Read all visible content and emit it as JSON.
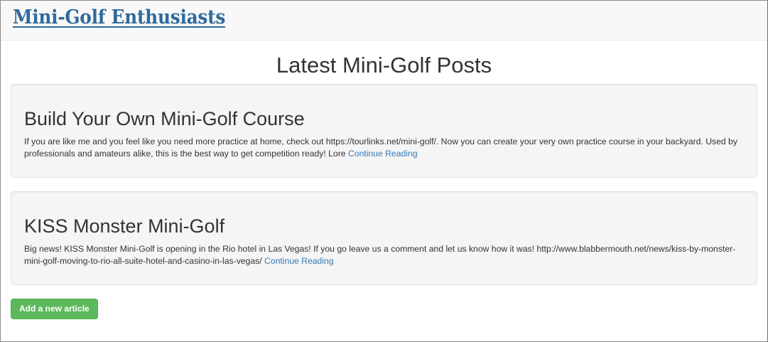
{
  "navbar": {
    "brand": "Mini-Golf Enthusiasts"
  },
  "main": {
    "title": "Latest Mini-Golf Posts",
    "posts": [
      {
        "title": "Build Your Own Mini-Golf Course",
        "excerpt": "If you are like me and you feel like you need more practice at home, check out https://tourlinks.net/mini-golf/. Now you can create your very own practice course in your backyard. Used by professionals and amateurs alike, this is the best way to get competition ready! Lore",
        "read_more": "Continue Reading"
      },
      {
        "title": "KISS Monster Mini-Golf",
        "excerpt": "Big news! KISS Monster Mini-Golf is opening in the Rio hotel in Las Vegas! If you go leave us a comment and let us know how it was! http://www.blabbermouth.net/news/kiss-by-monster-mini-golf-moving-to-rio-all-suite-hotel-and-casino-in-las-vegas/",
        "read_more": "Continue Reading"
      }
    ],
    "add_article_label": "Add a new article"
  },
  "colors": {
    "brand": "#2f6a9d",
    "link": "#337ab7",
    "success_button": "#5cb85c",
    "well_background": "#f5f5f5"
  }
}
